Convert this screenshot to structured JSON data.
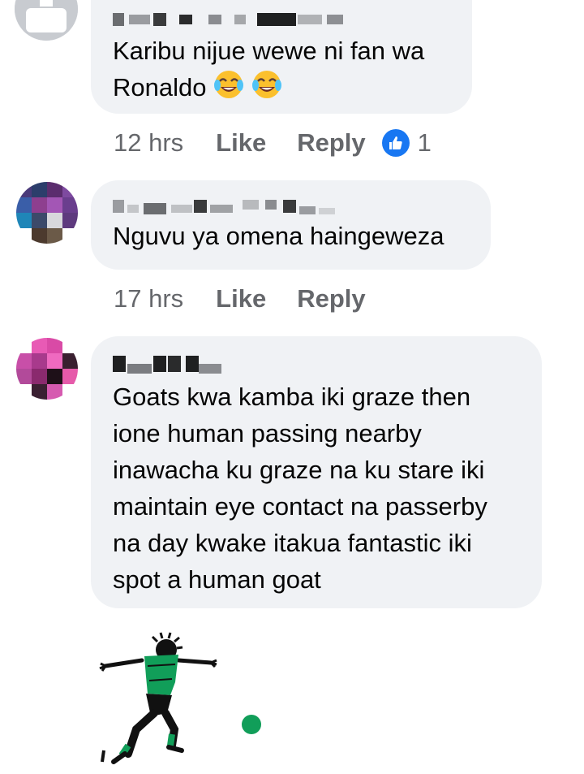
{
  "comments": [
    {
      "text_line1": "Karibu nijue wewe ni fan wa",
      "text_line2": "Ronaldo",
      "emoji": "face-with-tears-of-joy-icon",
      "time": "12 hrs",
      "like_label": "Like",
      "reply_label": "Reply",
      "reaction_count": "1"
    },
    {
      "text": "Nguvu ya omena haingeweza",
      "time": "17 hrs",
      "like_label": "Like",
      "reply_label": "Reply"
    },
    {
      "lines": [
        "Goats kwa kamba iki graze then",
        "ione human passing nearby",
        "inawacha ku graze na ku stare iki",
        "maintain eye contact na passerby",
        "na day kwake itakua fantastic iki",
        "spot a human goat"
      ]
    }
  ],
  "colors": {
    "bubble": "#f0f2f5",
    "meta_text": "#65676b",
    "like_blue": "#1877f2",
    "logo_green": "#119e59"
  }
}
